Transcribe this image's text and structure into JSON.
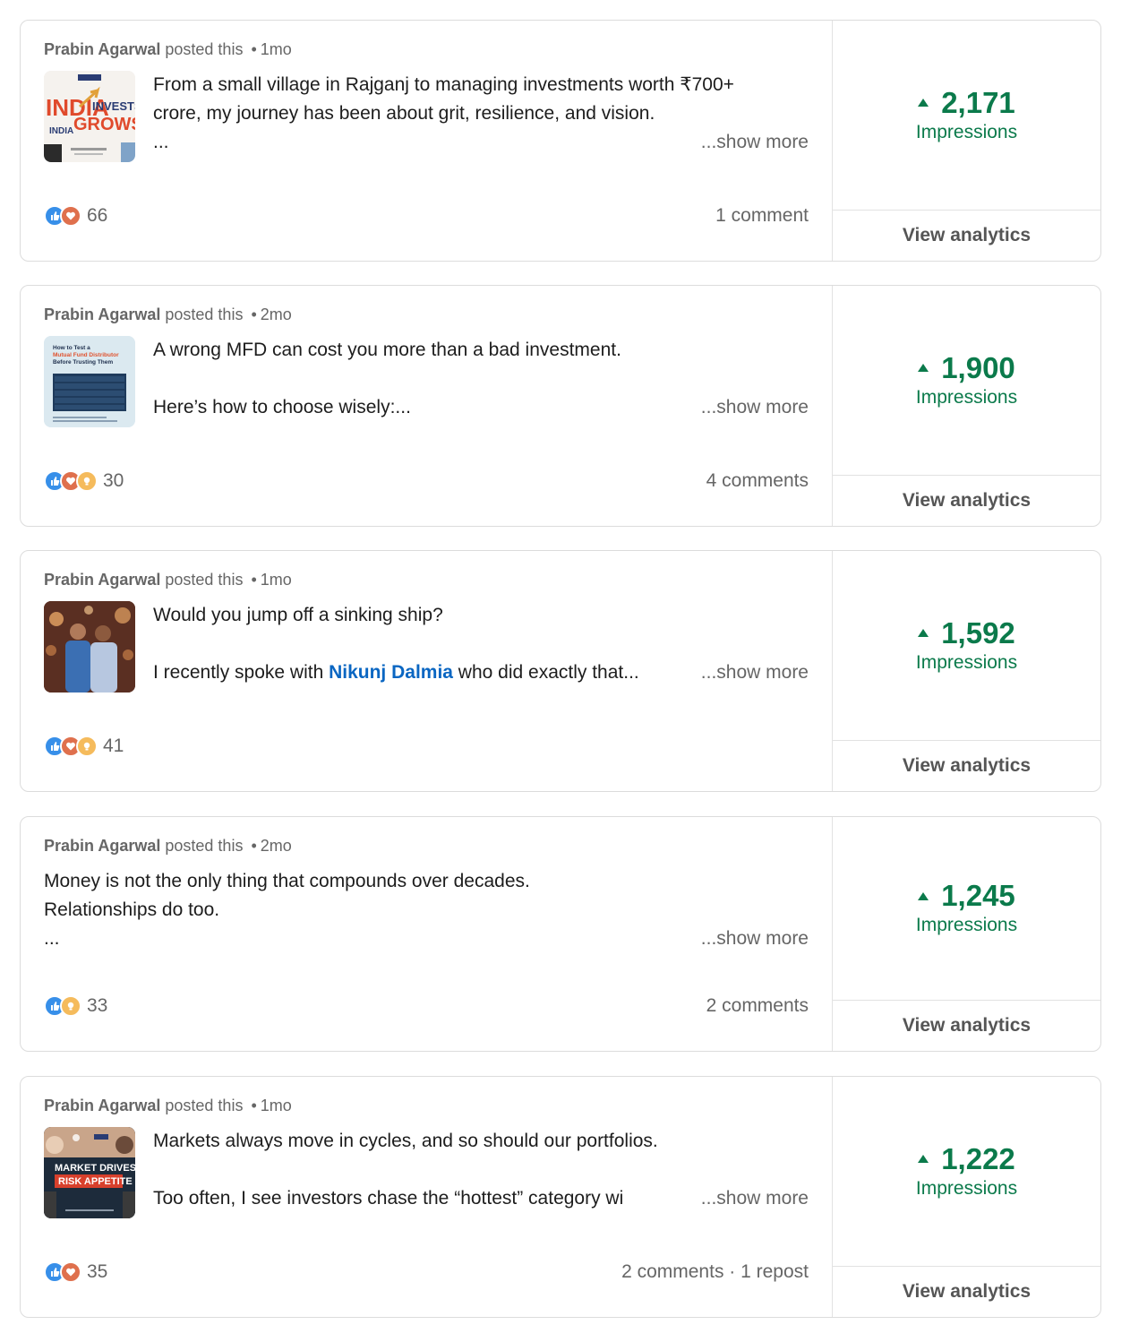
{
  "posts": [
    {
      "author": "Prabin Agarwal",
      "action": "posted this",
      "separator": "•",
      "age": "1mo",
      "lines": [
        "From a small village in Rajganj to managing investments worth ₹700+",
        "crore, my journey has been about grit, resilience, and vision.",
        "..."
      ],
      "show_more": "...show more",
      "thumbnail": {
        "texts": [
          "INDIA",
          "INVESTS,",
          "INDIA",
          "GROWS!"
        ]
      },
      "reaction_icons": [
        "like-icon",
        "love-icon"
      ],
      "reactions_count": "66",
      "engagement": "1 comment",
      "impressions_value": "2,171",
      "impressions_label": "Impressions",
      "analytics_label": "View analytics"
    },
    {
      "author": "Prabin Agarwal",
      "action": "posted this",
      "separator": "•",
      "age": "2mo",
      "lines": [
        "A wrong MFD can cost you more than a bad investment.",
        "",
        "Here’s how to choose wisely:..."
      ],
      "show_more": "...show more",
      "thumbnail": {
        "texts": [
          "How to Test a",
          "Mutual Fund Distributor",
          "Before Trusting Them"
        ]
      },
      "reaction_icons": [
        "like-icon",
        "love-icon",
        "insightful-icon"
      ],
      "reactions_count": "30",
      "engagement": "4 comments",
      "impressions_value": "1,900",
      "impressions_label": "Impressions",
      "analytics_label": "View analytics"
    },
    {
      "author": "Prabin Agarwal",
      "action": "posted this",
      "separator": "•",
      "age": "1mo",
      "lines": [
        "Would you jump off a sinking ship?",
        "",
        ""
      ],
      "line3": {
        "before": "I recently spoke with ",
        "mention": "Nikunj Dalmia",
        "after": " who did exactly that..."
      },
      "show_more": "...show more",
      "reaction_icons": [
        "like-icon",
        "love-icon",
        "insightful-icon"
      ],
      "reactions_count": "41",
      "engagement": "",
      "impressions_value": "1,592",
      "impressions_label": "Impressions",
      "analytics_label": "View analytics"
    },
    {
      "author": "Prabin Agarwal",
      "action": "posted this",
      "separator": "•",
      "age": "2mo",
      "lines": [
        "Money is not the only thing that compounds over decades.",
        "Relationships do too.",
        "..."
      ],
      "show_more": "...show more",
      "reaction_icons": [
        "like-icon",
        "insightful-icon"
      ],
      "reactions_count": "33",
      "engagement": "2 comments",
      "impressions_value": "1,245",
      "impressions_label": "Impressions",
      "analytics_label": "View analytics"
    },
    {
      "author": "Prabin Agarwal",
      "action": "posted this",
      "separator": "•",
      "age": "1mo",
      "lines": [
        "Markets always move in cycles, and so should our portfolios.",
        "",
        "Too often, I see investors chase the “hottest” category wi"
      ],
      "show_more": "...show more",
      "thumbnail": {
        "texts": [
          "MARKET DRIVES",
          "RISK APPETITE"
        ]
      },
      "reaction_icons": [
        "like-icon",
        "love-icon"
      ],
      "reactions_count": "35",
      "engagement": "2 comments · 1 repost",
      "impressions_value": "1,222",
      "impressions_label": "Impressions",
      "analytics_label": "View analytics"
    }
  ],
  "colors": {
    "impressions": "#0b7a4b",
    "mention": "#0a66c2",
    "like": "#378fe9",
    "love": "#df704d",
    "insightful": "#f5bb5c"
  }
}
